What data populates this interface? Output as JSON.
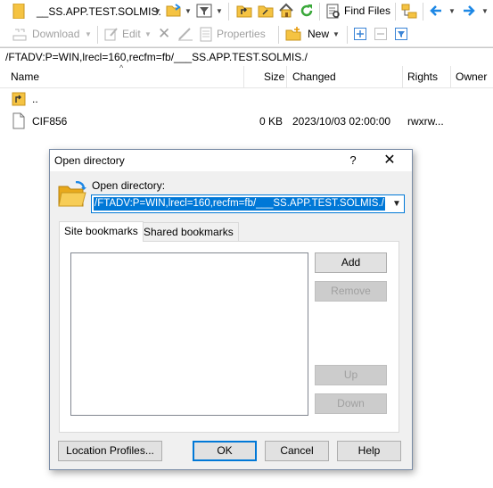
{
  "toolbar1": {
    "path_combo": "__SS.APP.TEST.SOLMIS.",
    "find_files": "Find Files",
    "icons": [
      "folder-icon",
      "open-folder-icon",
      "filter-icon",
      "parent-directory-icon",
      "root-directory-icon",
      "home-icon",
      "refresh-icon",
      "find-icon",
      "tree-icon",
      "back-arrow-icon",
      "forward-arrow-icon"
    ]
  },
  "toolbar2": {
    "download": "Download",
    "edit": "Edit",
    "properties": "Properties",
    "new": "New"
  },
  "path": "/FTADV:P=WIN,lrecl=160,recfm=fb/___SS.APP.TEST.SOLMIS./",
  "columns": {
    "name": "Name",
    "size": "Size",
    "changed": "Changed",
    "rights": "Rights",
    "owner": "Owner"
  },
  "files": [
    {
      "name": "..",
      "size": "",
      "changed": "",
      "rights": "",
      "icon": "parent-folder-icon"
    },
    {
      "name": "CIF856",
      "size": "0 KB",
      "changed": "2023/10/03 02:00:00",
      "rights": "rwxrw...",
      "icon": "file-icon"
    }
  ],
  "dialog": {
    "title": "Open directory",
    "help": "?",
    "close": "✕",
    "label": "Open directory:",
    "value": "/FTADV:P=WIN,lrecl=160,recfm=fb/___SS.APP.TEST.SOLMIS./",
    "tabs": [
      "Site bookmarks",
      "Shared bookmarks"
    ],
    "buttons": {
      "add": "Add",
      "remove": "Remove",
      "up": "Up",
      "down": "Down",
      "location_profiles": "Location Profiles...",
      "ok": "OK",
      "cancel": "Cancel",
      "help": "Help"
    }
  },
  "colors": {
    "accent": "#0078d7",
    "folder": "#f5c342",
    "refresh": "#3aa83a",
    "arrow": "#1e88e5"
  }
}
